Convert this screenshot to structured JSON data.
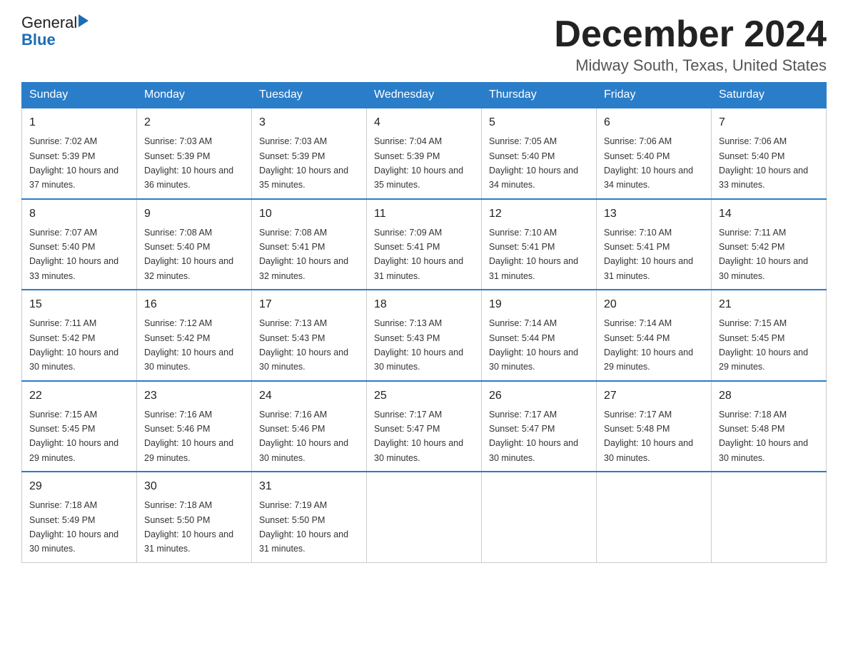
{
  "logo": {
    "line1": "General",
    "line2": "Blue"
  },
  "title": "December 2024",
  "subtitle": "Midway South, Texas, United States",
  "weekdays": [
    "Sunday",
    "Monday",
    "Tuesday",
    "Wednesday",
    "Thursday",
    "Friday",
    "Saturday"
  ],
  "weeks": [
    [
      {
        "day": "1",
        "sunrise": "7:02 AM",
        "sunset": "5:39 PM",
        "daylight": "10 hours and 37 minutes."
      },
      {
        "day": "2",
        "sunrise": "7:03 AM",
        "sunset": "5:39 PM",
        "daylight": "10 hours and 36 minutes."
      },
      {
        "day": "3",
        "sunrise": "7:03 AM",
        "sunset": "5:39 PM",
        "daylight": "10 hours and 35 minutes."
      },
      {
        "day": "4",
        "sunrise": "7:04 AM",
        "sunset": "5:39 PM",
        "daylight": "10 hours and 35 minutes."
      },
      {
        "day": "5",
        "sunrise": "7:05 AM",
        "sunset": "5:40 PM",
        "daylight": "10 hours and 34 minutes."
      },
      {
        "day": "6",
        "sunrise": "7:06 AM",
        "sunset": "5:40 PM",
        "daylight": "10 hours and 34 minutes."
      },
      {
        "day": "7",
        "sunrise": "7:06 AM",
        "sunset": "5:40 PM",
        "daylight": "10 hours and 33 minutes."
      }
    ],
    [
      {
        "day": "8",
        "sunrise": "7:07 AM",
        "sunset": "5:40 PM",
        "daylight": "10 hours and 33 minutes."
      },
      {
        "day": "9",
        "sunrise": "7:08 AM",
        "sunset": "5:40 PM",
        "daylight": "10 hours and 32 minutes."
      },
      {
        "day": "10",
        "sunrise": "7:08 AM",
        "sunset": "5:41 PM",
        "daylight": "10 hours and 32 minutes."
      },
      {
        "day": "11",
        "sunrise": "7:09 AM",
        "sunset": "5:41 PM",
        "daylight": "10 hours and 31 minutes."
      },
      {
        "day": "12",
        "sunrise": "7:10 AM",
        "sunset": "5:41 PM",
        "daylight": "10 hours and 31 minutes."
      },
      {
        "day": "13",
        "sunrise": "7:10 AM",
        "sunset": "5:41 PM",
        "daylight": "10 hours and 31 minutes."
      },
      {
        "day": "14",
        "sunrise": "7:11 AM",
        "sunset": "5:42 PM",
        "daylight": "10 hours and 30 minutes."
      }
    ],
    [
      {
        "day": "15",
        "sunrise": "7:11 AM",
        "sunset": "5:42 PM",
        "daylight": "10 hours and 30 minutes."
      },
      {
        "day": "16",
        "sunrise": "7:12 AM",
        "sunset": "5:42 PM",
        "daylight": "10 hours and 30 minutes."
      },
      {
        "day": "17",
        "sunrise": "7:13 AM",
        "sunset": "5:43 PM",
        "daylight": "10 hours and 30 minutes."
      },
      {
        "day": "18",
        "sunrise": "7:13 AM",
        "sunset": "5:43 PM",
        "daylight": "10 hours and 30 minutes."
      },
      {
        "day": "19",
        "sunrise": "7:14 AM",
        "sunset": "5:44 PM",
        "daylight": "10 hours and 30 minutes."
      },
      {
        "day": "20",
        "sunrise": "7:14 AM",
        "sunset": "5:44 PM",
        "daylight": "10 hours and 29 minutes."
      },
      {
        "day": "21",
        "sunrise": "7:15 AM",
        "sunset": "5:45 PM",
        "daylight": "10 hours and 29 minutes."
      }
    ],
    [
      {
        "day": "22",
        "sunrise": "7:15 AM",
        "sunset": "5:45 PM",
        "daylight": "10 hours and 29 minutes."
      },
      {
        "day": "23",
        "sunrise": "7:16 AM",
        "sunset": "5:46 PM",
        "daylight": "10 hours and 29 minutes."
      },
      {
        "day": "24",
        "sunrise": "7:16 AM",
        "sunset": "5:46 PM",
        "daylight": "10 hours and 30 minutes."
      },
      {
        "day": "25",
        "sunrise": "7:17 AM",
        "sunset": "5:47 PM",
        "daylight": "10 hours and 30 minutes."
      },
      {
        "day": "26",
        "sunrise": "7:17 AM",
        "sunset": "5:47 PM",
        "daylight": "10 hours and 30 minutes."
      },
      {
        "day": "27",
        "sunrise": "7:17 AM",
        "sunset": "5:48 PM",
        "daylight": "10 hours and 30 minutes."
      },
      {
        "day": "28",
        "sunrise": "7:18 AM",
        "sunset": "5:48 PM",
        "daylight": "10 hours and 30 minutes."
      }
    ],
    [
      {
        "day": "29",
        "sunrise": "7:18 AM",
        "sunset": "5:49 PM",
        "daylight": "10 hours and 30 minutes."
      },
      {
        "day": "30",
        "sunrise": "7:18 AM",
        "sunset": "5:50 PM",
        "daylight": "10 hours and 31 minutes."
      },
      {
        "day": "31",
        "sunrise": "7:19 AM",
        "sunset": "5:50 PM",
        "daylight": "10 hours and 31 minutes."
      },
      null,
      null,
      null,
      null
    ]
  ]
}
